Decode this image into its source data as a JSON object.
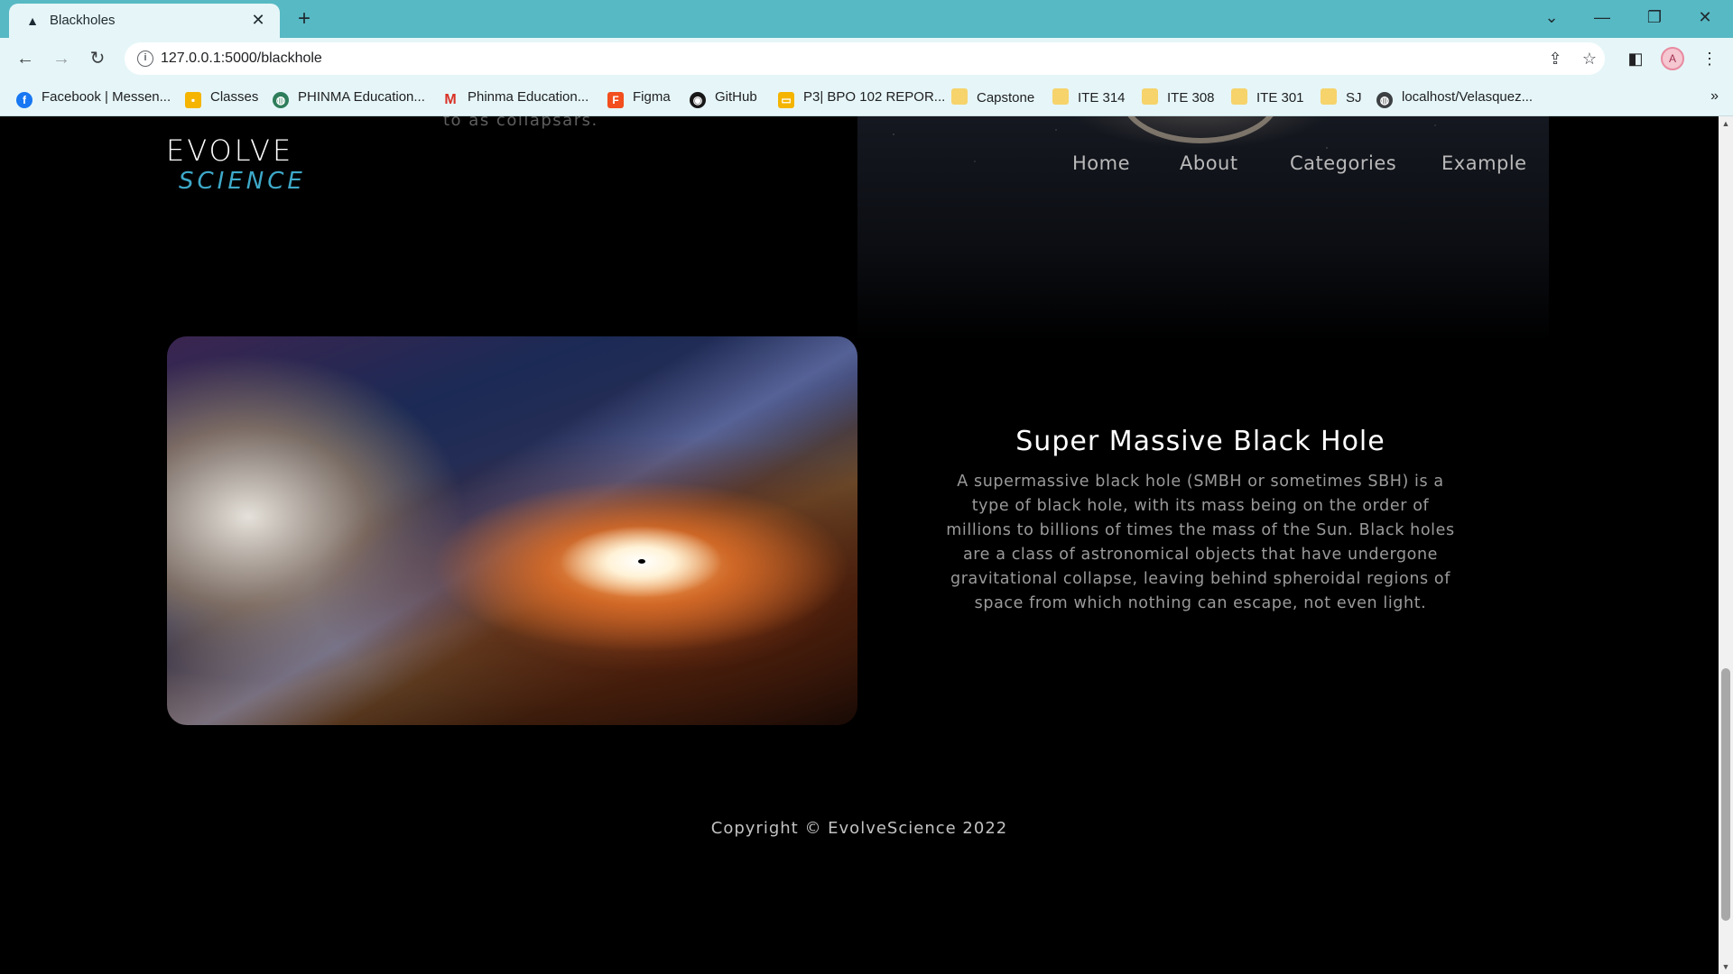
{
  "browser": {
    "tab_title": "Blackholes",
    "url": "127.0.0.1:5000/blackhole",
    "bookmarks": [
      {
        "label": "Facebook | Messen...",
        "icon": "facebook-icon",
        "color": "#1877f2"
      },
      {
        "label": "Classes",
        "icon": "classroom-icon",
        "color": "#f4b400"
      },
      {
        "label": "PHINMA Education...",
        "icon": "globe-icon",
        "color": "#2e7d5b"
      },
      {
        "label": "Phinma Education...",
        "icon": "gmail-icon",
        "color": "#d93025"
      },
      {
        "label": "Figma",
        "icon": "figma-icon",
        "color": "#f24e1e"
      },
      {
        "label": "GitHub",
        "icon": "github-icon",
        "color": "#181717"
      },
      {
        "label": "P3| BPO 102 REPOR...",
        "icon": "slides-icon",
        "color": "#f4b400"
      },
      {
        "label": "Capstone",
        "icon": "folder-icon",
        "color": "#f6d36b"
      },
      {
        "label": "ITE 314",
        "icon": "folder-icon",
        "color": "#f6d36b"
      },
      {
        "label": "ITE 308",
        "icon": "folder-icon",
        "color": "#f6d36b"
      },
      {
        "label": "ITE 301",
        "icon": "folder-icon",
        "color": "#f6d36b"
      },
      {
        "label": "SJ",
        "icon": "folder-icon",
        "color": "#f6d36b"
      },
      {
        "label": "localhost/Velasquez...",
        "icon": "globe-icon",
        "color": "#3c4043"
      }
    ],
    "bookmarks_more": "»"
  },
  "page": {
    "previous_text_fragment": "to as collapsars.",
    "logo": {
      "top": "EVOLVE",
      "bottom": "SCIENCE"
    },
    "nav": [
      "Home",
      "About",
      "Categories",
      "Example"
    ],
    "section": {
      "title": "Super Massive Black Hole",
      "description": "A supermassive black hole (SMBH or sometimes SBH) is a type of black hole, with its mass being on the order of millions to billions of times the mass of the Sun. Black holes are a class of astronomical objects that have undergone gravitational collapse, leaving behind spheroidal regions of space from which nothing can escape, not even light.",
      "image": "supermassive-black-hole-accretion-disk"
    },
    "footer": "Copyright © EvolveScience 2022"
  },
  "colors": {
    "tabstrip": "#57b9c4",
    "toolbar": "#e6f6f8",
    "page_bg": "#000000",
    "logo_accent": "#3ea9c9",
    "nav_text": "#b9b9b9"
  }
}
